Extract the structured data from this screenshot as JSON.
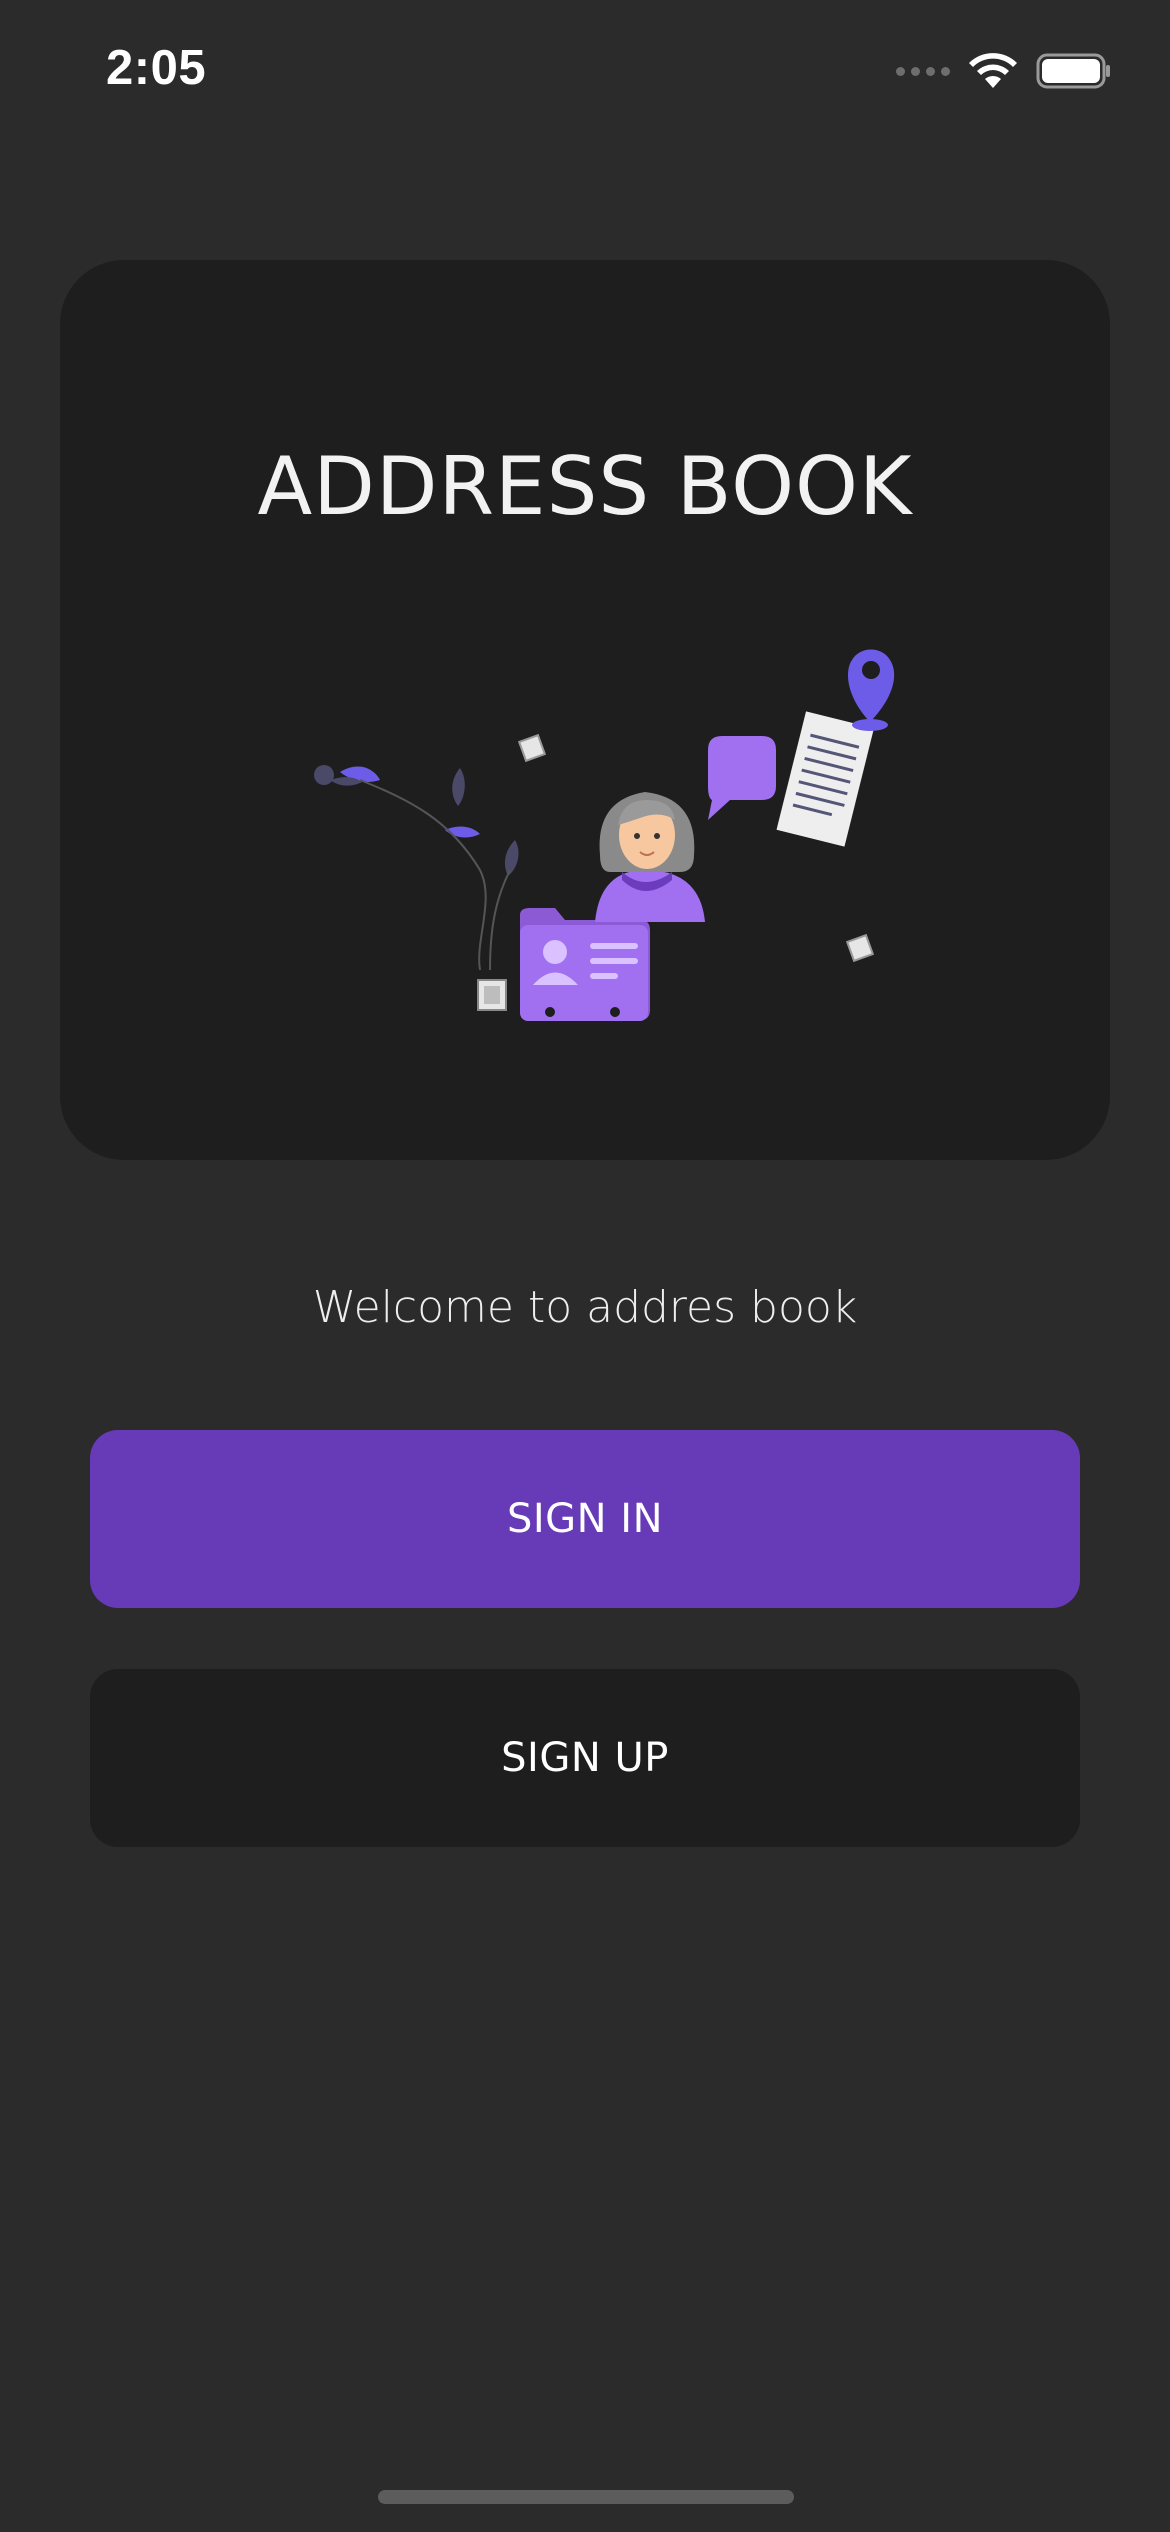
{
  "status_bar": {
    "time": "2:05",
    "icons": [
      "signal-dots-icon",
      "wifi-icon",
      "battery-icon"
    ]
  },
  "hero": {
    "title": "ADDRESS BOOK",
    "illustration": "address-book-illustration"
  },
  "welcome_text": "Welcome to addres book",
  "buttons": {
    "sign_in": "SIGN IN",
    "sign_up": "SIGN UP"
  },
  "colors": {
    "background": "#2b2b2b",
    "card": "#1e1e1e",
    "accent": "#673ab7",
    "illustration_purple": "#a070f0",
    "illustration_blue": "#6c5ce7"
  }
}
